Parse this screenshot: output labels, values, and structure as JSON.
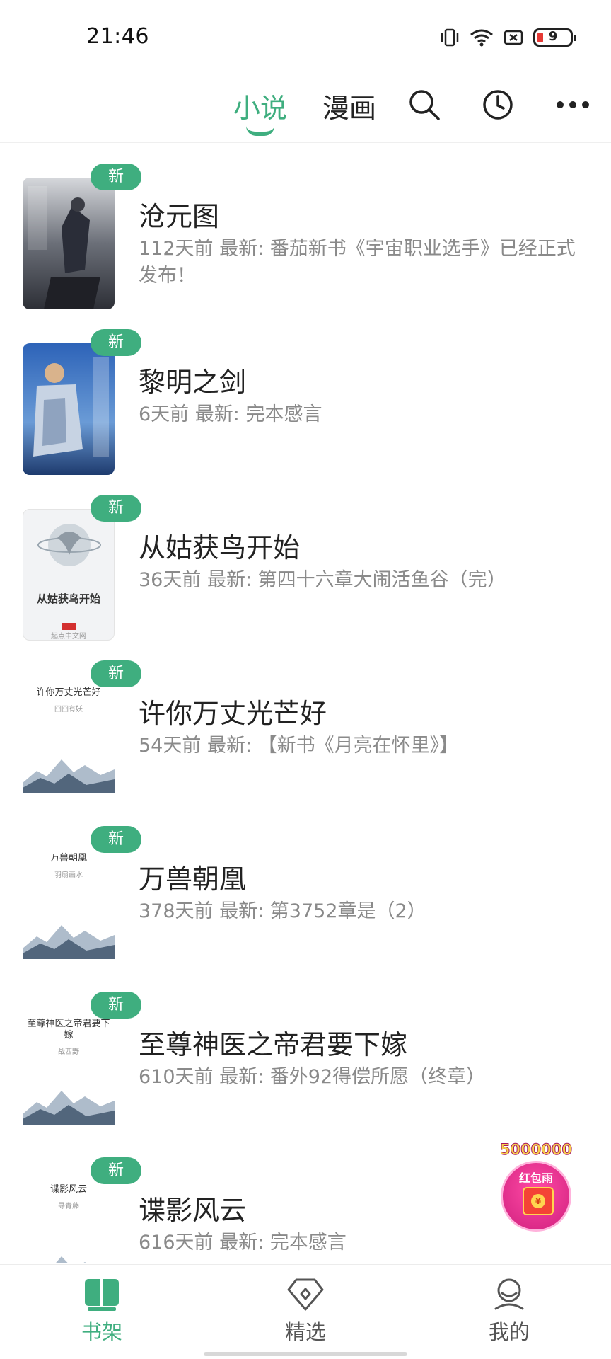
{
  "status_bar": {
    "time": "21:46",
    "battery_level": "9",
    "icons": [
      "vibrate-icon",
      "wifi-icon",
      "sim-off-icon",
      "battery-icon"
    ]
  },
  "top_nav": {
    "tabs": [
      {
        "label": "小说",
        "active": true
      },
      {
        "label": "漫画",
        "active": false
      }
    ],
    "icons": [
      "search-icon",
      "history-clock-icon",
      "more-icon"
    ],
    "accent_color": "#3fae7f"
  },
  "books": [
    {
      "title": "沧元图",
      "meta": "112天前 最新: 番茄新书《宇宙职业选手》已经正式发布！",
      "badge": "新",
      "cover_title": "",
      "cover_author": ""
    },
    {
      "title": "黎明之剑",
      "meta": "6天前 最新: 完本感言",
      "badge": "新",
      "cover_title": "",
      "cover_author": ""
    },
    {
      "title": "从姑获鸟开始",
      "meta": "36天前 最新: 第四十六章大闹活鱼谷（完）",
      "badge": "新",
      "cover_title": "从姑获鸟开始",
      "cover_author": "起点中文网"
    },
    {
      "title": "许你万丈光芒好",
      "meta": "54天前 最新: 【新书《月亮在怀里》】",
      "badge": "新",
      "cover_title": "许你万丈光芒好",
      "cover_author": "囧囧有妖"
    },
    {
      "title": "万兽朝凰",
      "meta": "378天前 最新: 第3752章是（2）",
      "badge": "新",
      "cover_title": "万兽朝凰",
      "cover_author": "羽扇画水"
    },
    {
      "title": "至尊神医之帝君要下嫁",
      "meta": "610天前 最新: 番外92得偿所愿（终章）",
      "badge": "新",
      "cover_title": "至尊神医之帝君要下嫁",
      "cover_author": "战西野"
    },
    {
      "title": "谍影风云",
      "meta": "616天前 最新: 完本感言",
      "badge": "新",
      "cover_title": "谍影风云",
      "cover_author": "寻青藤"
    }
  ],
  "promo": {
    "amount": "5000000",
    "label": "红包雨"
  },
  "bottom_nav": [
    {
      "label": "书架",
      "icon": "bookshelf-icon",
      "active": true
    },
    {
      "label": "精选",
      "icon": "diamond-icon",
      "active": false
    },
    {
      "label": "我的",
      "icon": "profile-icon",
      "active": false
    }
  ]
}
